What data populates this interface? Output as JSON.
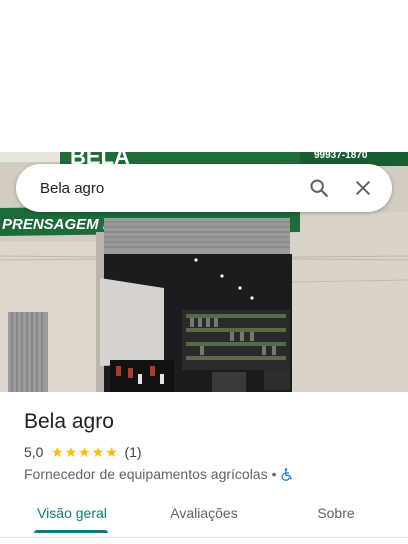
{
  "search": {
    "value": "Bela agro",
    "placeholder": ""
  },
  "photo": {
    "facade_sign_text": "PRENSAGEM DE MANGUEIRAS",
    "logo_partial_text": "BELA",
    "phone_partial": "99937-1870"
  },
  "place": {
    "name": "Bela agro",
    "rating": "5,0",
    "rating_value": 5.0,
    "stars_max": 5,
    "review_count": "(1)",
    "category": "Fornecedor de equipamentos agrícolas",
    "separator": "•",
    "accessibility_icon": "wheelchair-icon"
  },
  "tabs": [
    {
      "label": "Visão geral",
      "active": true
    },
    {
      "label": "Avaliações",
      "active": false
    },
    {
      "label": "Sobre",
      "active": false
    }
  ],
  "colors": {
    "accent": "#0b7a85",
    "star": "#fbbc04",
    "sign_green": "#1e6b3a",
    "accessibility_blue": "#1a73e8"
  }
}
